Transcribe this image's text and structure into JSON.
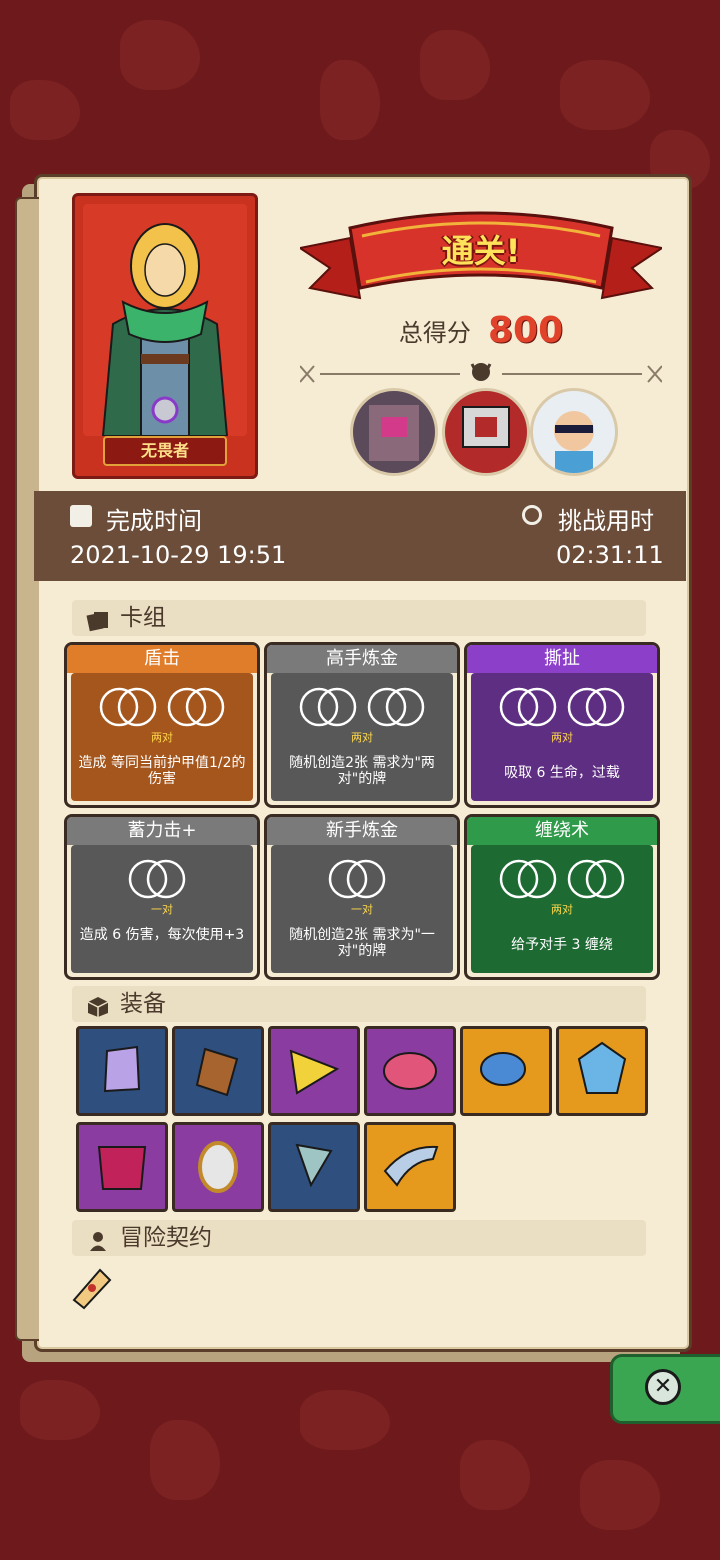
{
  "hero": {
    "name": "无畏者"
  },
  "result": {
    "banner": "通关!",
    "score_label": "总得分",
    "score_value": "800"
  },
  "info": {
    "finish_label": "完成时间",
    "finish_value": "2021-10-29 19:51",
    "duration_label": "挑战用时",
    "duration_value": "02:31:11"
  },
  "deck": {
    "title": "卡组",
    "cards": [
      {
        "name": "盾击",
        "req": "两对",
        "desc": "造成 等同当前护甲值1/2的伤害",
        "color": "orange"
      },
      {
        "name": "高手炼金",
        "req": "两对",
        "desc": "随机创造2张 需求为\"两对\"的牌",
        "color": "grey"
      },
      {
        "name": "撕扯",
        "req": "两对",
        "desc": "吸取 6 生命，过载",
        "color": "purple"
      },
      {
        "name": "蓄力击+",
        "req": "一对",
        "desc": "造成 6 伤害，每次使用+3",
        "color": "grey"
      },
      {
        "name": "新手炼金",
        "req": "一对",
        "desc": "随机创造2张 需求为\"一对\"的牌",
        "color": "grey"
      },
      {
        "name": "缠绕术",
        "req": "两对",
        "desc": "给予对手 3 缠绕",
        "color": "green"
      }
    ]
  },
  "equipment": {
    "title": "装备"
  },
  "contract": {
    "title": "冒险契约"
  },
  "colors": {
    "bg": "#6e1a1c",
    "panel": "#f6ecd4",
    "score": "#e0422a",
    "accent_yellow": "#ffd84a"
  }
}
